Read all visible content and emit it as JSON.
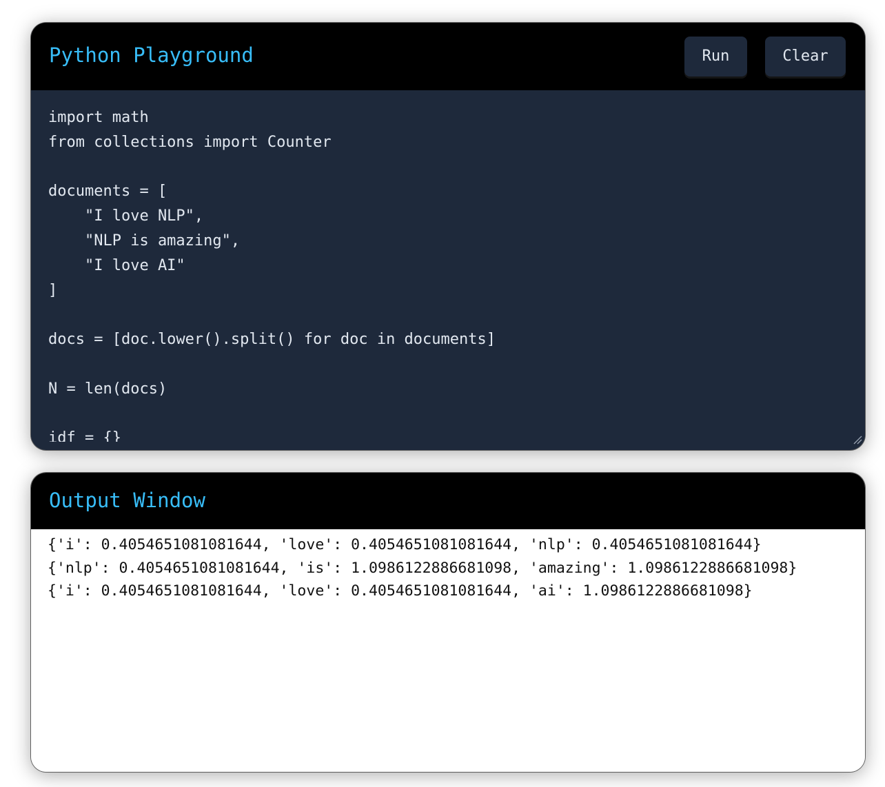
{
  "editor": {
    "title": "Python Playground",
    "run_label": "Run",
    "clear_label": "Clear",
    "code": "import math\nfrom collections import Counter\n\ndocuments = [\n    \"I love NLP\",\n    \"NLP is amazing\",\n    \"I love AI\"\n]\n\ndocs = [doc.lower().split() for doc in documents]\n\nN = len(docs)\n\nidf = {}"
  },
  "output": {
    "title": "Output Window",
    "lines": [
      "{'i': 0.4054651081081644, 'love': 0.4054651081081644, 'nlp': 0.4054651081081644}",
      "{'nlp': 0.4054651081081644, 'is': 1.0986122886681098, 'amazing': 1.0986122886681098}",
      "{'i': 0.4054651081081644, 'love': 0.4054651081081644, 'ai': 1.0986122886681098}"
    ]
  },
  "colors": {
    "accent": "#38bdf8",
    "header_bg": "#000000",
    "editor_bg": "#1e293b",
    "button_bg": "#1e293b",
    "code_text": "#e2e8f0"
  }
}
